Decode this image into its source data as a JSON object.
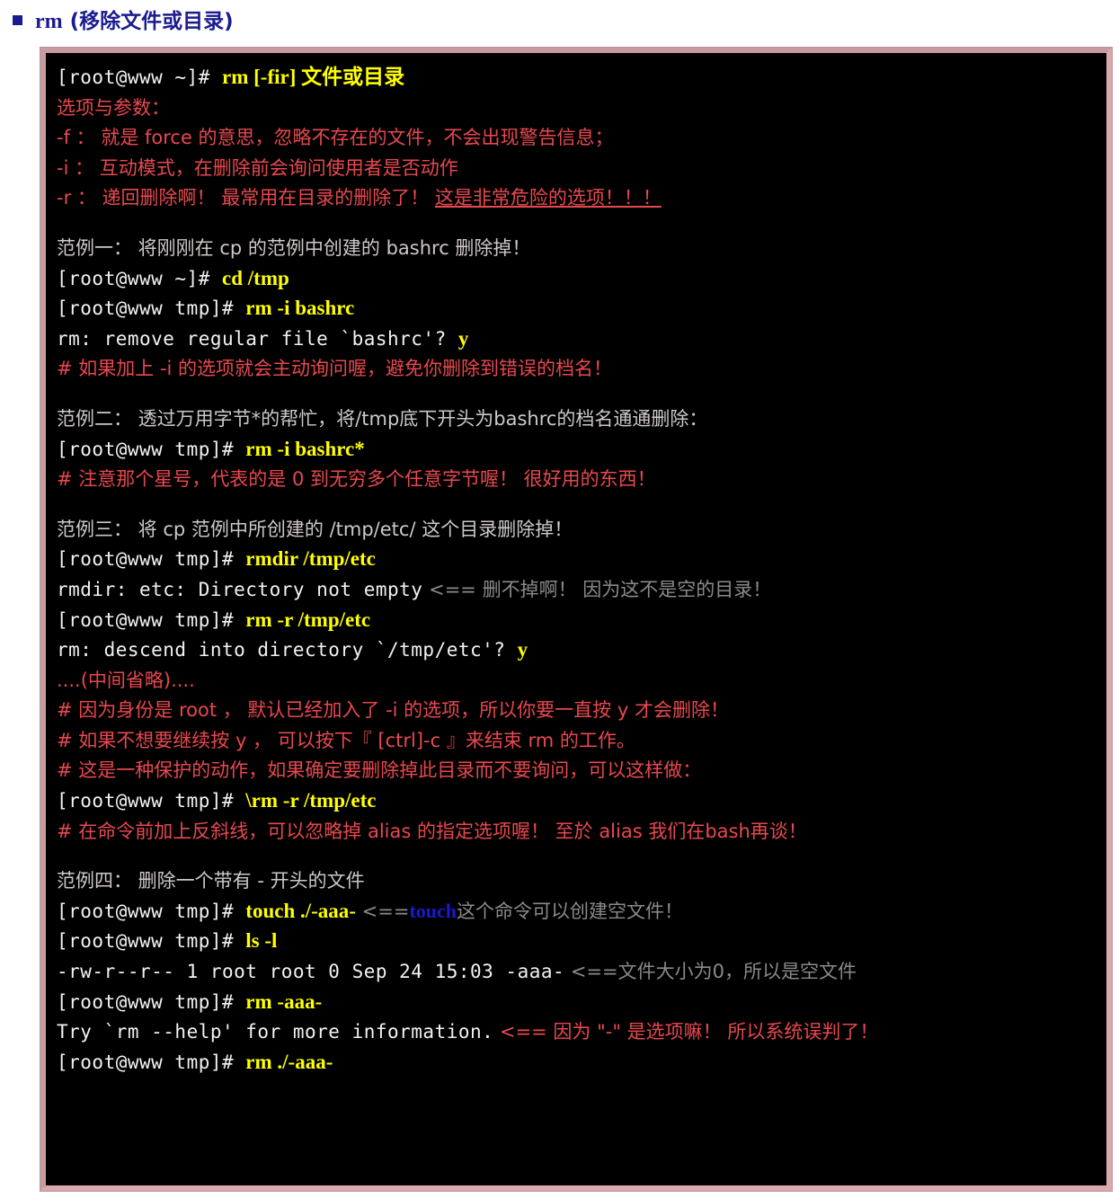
{
  "heading": {
    "bullet_icon": "square-bullet-icon",
    "command": "rm",
    "title_cjk": " (移除文件或目录)"
  },
  "colors": {
    "heading": "#1b1b8f",
    "frame_border": "#d9a9ad",
    "terminal_bg": "#000000",
    "prompt_text": "#f2f2f2",
    "command_yellow": "#ffff00",
    "red_comment": "#e8484f",
    "gray_annotation": "#8a8a8a",
    "blue_word": "#1a1ad0",
    "description_text": "#cfc7c7"
  },
  "terminal": {
    "lines": [
      {
        "id": "usage",
        "type": "prompt",
        "prompt": "[root@www ~]# ",
        "command": "rm [-fir] 文件或目录"
      },
      {
        "id": "opts-header",
        "type": "red",
        "text": "选项与参数："
      },
      {
        "id": "opt-f",
        "type": "red",
        "text": "-f ： 就是 force 的意思，忽略不存在的文件，不会出现警告信息；"
      },
      {
        "id": "opt-i",
        "type": "red",
        "text": "-i ： 互动模式，在删除前会询问使用者是否动作"
      },
      {
        "id": "opt-r",
        "type": "red",
        "text": "-r ： 递回删除啊！ 最常用在目录的删除了！ ",
        "underlined": "这是非常危险的选项！！！ "
      },
      {
        "id": "blank-1",
        "type": "blank"
      },
      {
        "id": "ex1-desc",
        "type": "desc",
        "text": "范例一： 将刚刚在 cp 的范例中创建的 bashrc 删除掉！"
      },
      {
        "id": "ex1-cd",
        "type": "prompt",
        "prompt": "[root@www ~]# ",
        "command": "cd /tmp"
      },
      {
        "id": "ex1-rm",
        "type": "prompt",
        "prompt": "[root@www tmp]# ",
        "command": "rm -i bashrc"
      },
      {
        "id": "ex1-out",
        "type": "output",
        "text": "rm: remove regular file `bashrc'? ",
        "answer": "y"
      },
      {
        "id": "ex1-cmt",
        "type": "red",
        "text": "# 如果加上 -i 的选项就会主动询问喔，避免你删除到错误的档名！"
      },
      {
        "id": "blank-2",
        "type": "blank"
      },
      {
        "id": "ex2-desc",
        "type": "desc",
        "text": "范例二： 透过万用字节*的帮忙，将/tmp底下开头为bashrc的档名通通删除："
      },
      {
        "id": "ex2-rm",
        "type": "prompt",
        "prompt": "[root@www tmp]# ",
        "command": "rm -i bashrc*"
      },
      {
        "id": "ex2-cmt",
        "type": "red",
        "text": "# 注意那个星号，代表的是 0 到无穷多个任意字节喔！ 很好用的东西！"
      },
      {
        "id": "blank-3",
        "type": "blank"
      },
      {
        "id": "ex3-desc",
        "type": "desc",
        "text": "范例三： 将 cp 范例中所创建的 /tmp/etc/ 这个目录删除掉！"
      },
      {
        "id": "ex3-rmdir",
        "type": "prompt",
        "prompt": "[root@www tmp]# ",
        "command": "rmdir /tmp/etc"
      },
      {
        "id": "ex3-out1",
        "type": "output",
        "text": "rmdir: etc: Directory not empty",
        "annotation_gray": "   <== 删不掉啊！ 因为这不是空的目录！"
      },
      {
        "id": "ex3-rmr",
        "type": "prompt",
        "prompt": "[root@www tmp]# ",
        "command": "rm -r /tmp/etc"
      },
      {
        "id": "ex3-out2",
        "type": "output",
        "text": "rm: descend into directory `/tmp/etc'? ",
        "answer": "y"
      },
      {
        "id": "ex3-omit",
        "type": "red",
        "text": "....(中间省略)...."
      },
      {
        "id": "ex3-cmt1",
        "type": "red",
        "text": "# 因为身份是 root ， 默认已经加入了 -i 的选项，所以你要一直按 y 才会删除！"
      },
      {
        "id": "ex3-cmt2",
        "type": "red",
        "text": "# 如果不想要继续按 y ， 可以按下『 [ctrl]-c 』来结束 rm 的工作。"
      },
      {
        "id": "ex3-cmt3",
        "type": "red",
        "text": "# 这是一种保护的动作，如果确定要删除掉此目录而不要询问，可以这样做："
      },
      {
        "id": "ex3-rmbs",
        "type": "prompt",
        "prompt": "[root@www tmp]# ",
        "command": "\\rm -r /tmp/etc"
      },
      {
        "id": "ex3-cmt4",
        "type": "red",
        "text": "# 在命令前加上反斜线，可以忽略掉 alias 的指定选项喔！ 至於 alias 我们在bash再谈！"
      },
      {
        "id": "blank-4",
        "type": "blank"
      },
      {
        "id": "ex4-desc",
        "type": "desc",
        "text": "范例四： 删除一个带有 - 开头的文件"
      },
      {
        "id": "ex4-touch",
        "type": "prompt",
        "prompt": "[root@www tmp]# ",
        "command": "touch ./-aaa-",
        "annotation_gray_pre": "   <==",
        "annotation_blue": "touch",
        "annotation_gray_post": "这个命令可以创建空文件！"
      },
      {
        "id": "ex4-ls",
        "type": "prompt",
        "prompt": "[root@www tmp]# ",
        "command": "ls -l"
      },
      {
        "id": "ex4-lsout",
        "type": "output",
        "text": "-rw-r--r-- 1 root  root        0 Sep 24 15:03 -aaa-",
        "annotation_gray": "  <==文件大小为0，所以是空文件"
      },
      {
        "id": "ex4-rmbad",
        "type": "prompt",
        "prompt": "[root@www tmp]# ",
        "command": "rm -aaa-"
      },
      {
        "id": "ex4-try",
        "type": "output",
        "text": "Try `rm --help' for more information.",
        "annotation_red": "  <== 因为 \"-\" 是选项嘛！ 所以系统误判了！"
      },
      {
        "id": "ex4-rmok",
        "type": "prompt",
        "prompt": "[root@www tmp]# ",
        "command": "rm ./-aaa-"
      }
    ]
  }
}
